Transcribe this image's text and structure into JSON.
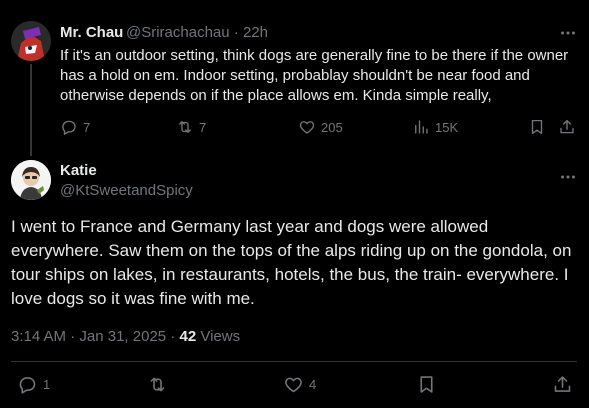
{
  "reply": {
    "author_name": "Mr. Chau",
    "author_handle": "@Srirachachau",
    "separator": "·",
    "time": "22h",
    "text": "If it's an outdoor setting, think dogs are generally fine to be there if the owner has a hold on em. Indoor setting, probablay shouldn't be near food and otherwise depends on if the place allows em. Kinda simple really,",
    "replies": "7",
    "reposts": "7",
    "likes": "205",
    "views": "15K"
  },
  "post": {
    "author_name": "Katie",
    "author_handle": "@KtSweetandSpicy",
    "text": "I went to France and Germany last year and dogs were allowed everywhere. Saw them on the tops of the alps riding up on the gondola, on tour ships on lakes, in restaurants, hotels, the bus, the train- everywhere. I love dogs so it was fine with me.",
    "time": "3:14 AM",
    "date": "Jan 31, 2025",
    "meta_separator": "·",
    "views_count": "42",
    "views_label": "Views",
    "replies": "1",
    "likes": "4"
  },
  "colors": {
    "background": "#000000",
    "text_primary": "#e7e9ea",
    "text_secondary": "#71767b",
    "divider": "#2f3336"
  },
  "icons": {
    "reply": "reply-icon",
    "repost": "repost-icon",
    "like": "heart-icon",
    "views": "views-icon",
    "bookmark": "bookmark-icon",
    "share": "share-icon",
    "more": "more-icon"
  }
}
